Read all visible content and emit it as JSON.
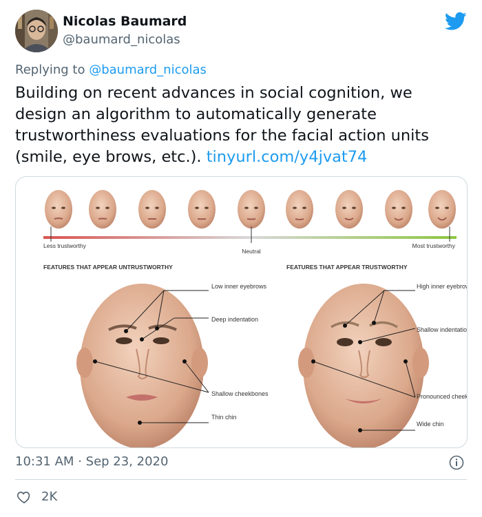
{
  "author": {
    "name": "Nicolas Baumard",
    "handle": "@baumard_nicolas"
  },
  "reply": {
    "prefix": "Replying to",
    "to": "@baumard_nicolas"
  },
  "tweet": {
    "text": "Building on recent advances in social cognition, we design an algorithm to automatically generate trustworthiness evaluations for the facial action units (smile, eye brows, etc.).",
    "link": "tinyurl.com/y4jvat74"
  },
  "figure": {
    "scale_left": "Less trustworthy",
    "scale_middle": "Neutral",
    "scale_right": "Most trustworthy",
    "left_title": "FEATURES THAT APPEAR UNTRUSTWORTHY",
    "right_title": "FEATURES THAT APPEAR TRUSTWORTHY",
    "left_labels": [
      "Low inner eyebrows",
      "Deep indentation",
      "Shallow cheekbones",
      "Thin chin"
    ],
    "right_labels": [
      "High inner eyebrows",
      "Shallow indentation",
      "Pronounced cheekbones",
      "Wide chin"
    ]
  },
  "meta": {
    "time": "10:31 AM",
    "separator": "·",
    "date": "Sep 23, 2020"
  },
  "stats": {
    "likes": "2K"
  },
  "colors": {
    "link": "#1d9bf0",
    "secondary": "#536471",
    "scale_red": "#d9534f",
    "scale_green": "#8cc63f"
  },
  "icons": [
    "twitter-bird-icon",
    "info-icon",
    "heart-icon"
  ]
}
